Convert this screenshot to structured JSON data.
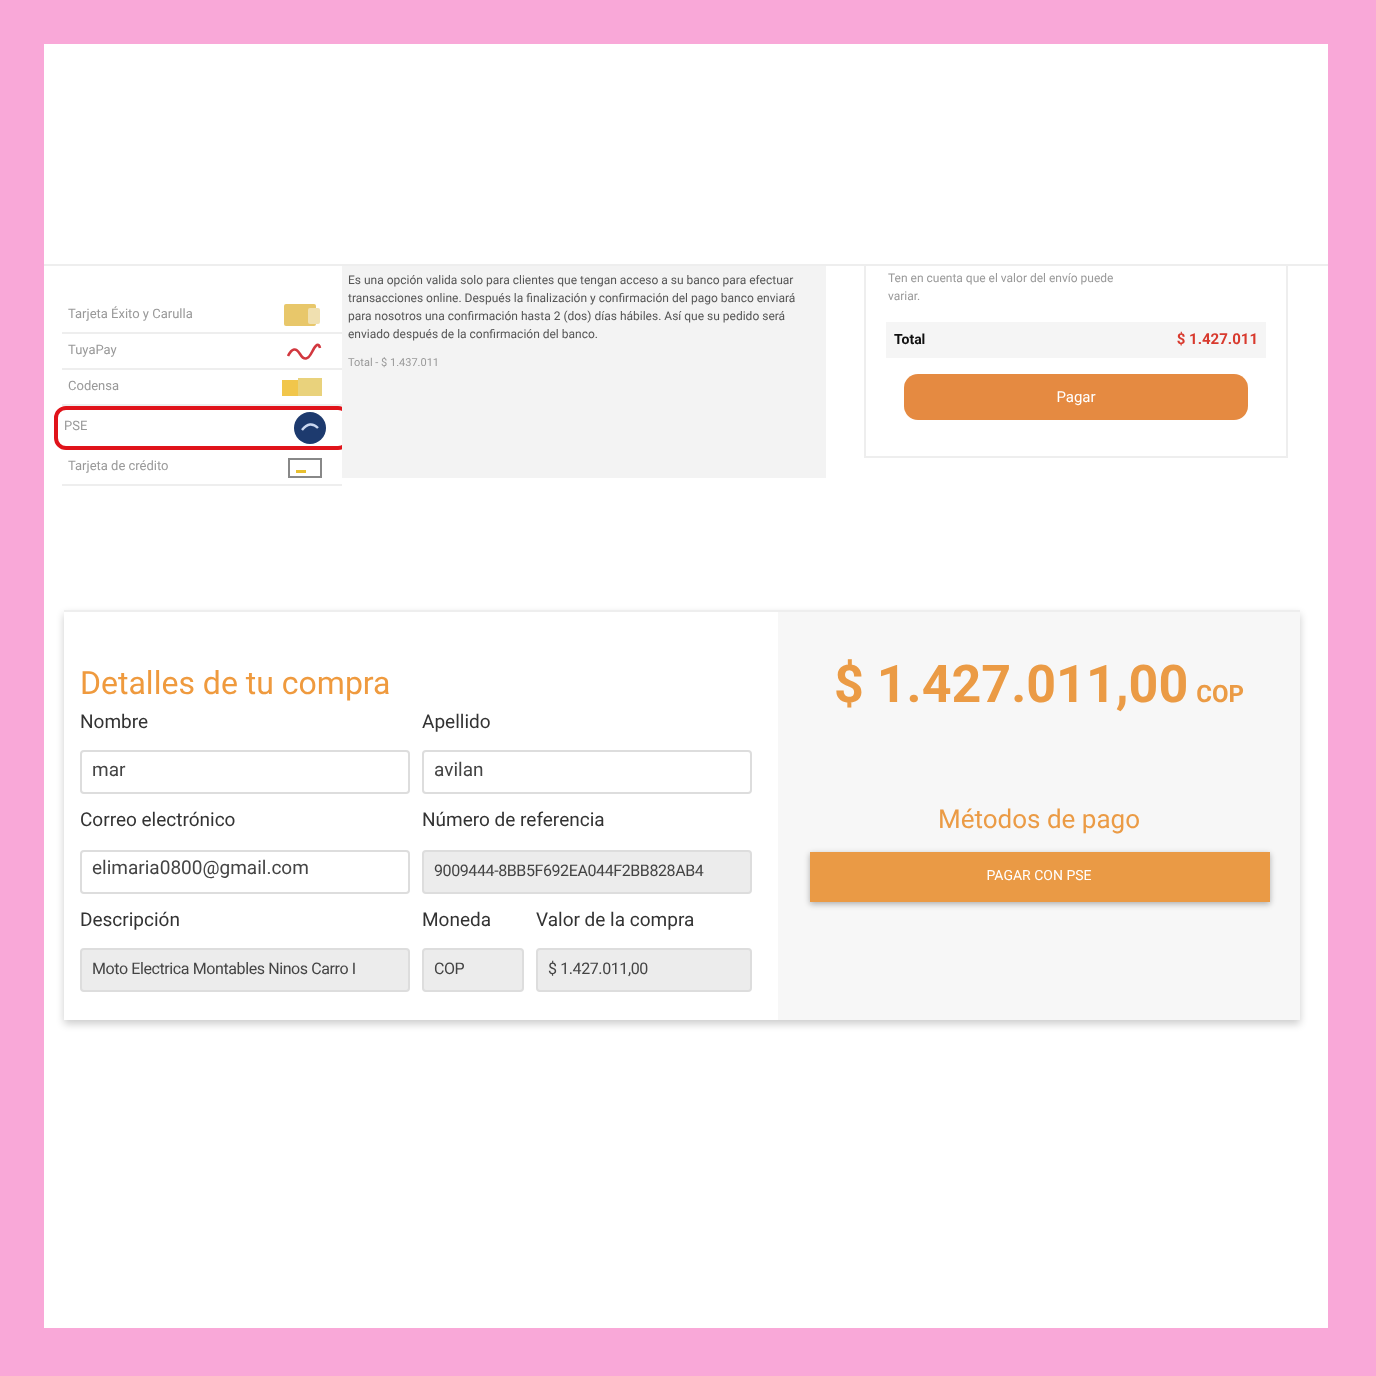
{
  "checkout": {
    "methods": [
      {
        "label": "Tarjeta Éxito y Carulla",
        "kind": "card-gold",
        "selected": false
      },
      {
        "label": "TuyaPay",
        "kind": "script-logo",
        "selected": false
      },
      {
        "label": "Codensa",
        "kind": "card-yellow",
        "selected": false
      },
      {
        "label": "PSE",
        "kind": "round-logo",
        "selected": true
      },
      {
        "label": "Tarjeta de crédito",
        "kind": "card-outline",
        "selected": false
      }
    ],
    "description": "Es una opción valida solo para clientes que tengan acceso a su banco para efectuar transacciones online. Después la finalización y confirmación del pago banco enviará para nosotros una confirmación hasta 2 (dos) días hábiles. Así que su pedido será enviado después de la confirmación del banco.",
    "total_line": "Total - $ 1.437.011",
    "note": "Ten en cuenta que el valor del envío puede variar.",
    "total_label": "Total",
    "total_value": "$ 1.427.011",
    "pay_button": "Pagar"
  },
  "payment": {
    "title": "Detalles de tu compra",
    "fields": [
      {
        "label": "Nombre",
        "value": "mar",
        "disabled": false
      },
      {
        "label": "Apellido",
        "value": "avilan",
        "disabled": false
      },
      {
        "label": "Correo electrónico",
        "value": "elimaria0800@gmail.com",
        "disabled": false
      },
      {
        "label": "Número de referencia",
        "value": "9009444-8BB5F692EA044F2BB828AB4",
        "disabled": true
      },
      {
        "label": "Descripción",
        "value": "Moto Electrica Montables Ninos Carro I",
        "disabled": true
      },
      {
        "label": "Moneda",
        "value": "COP",
        "disabled": true
      },
      {
        "label": "Valor de la compra",
        "value": "$ 1.427.011,00",
        "disabled": true
      }
    ],
    "amount": "$ 1.427.011,00",
    "currency": "COP",
    "methods_title": "Métodos de pago",
    "pse_button": "PAGAR CON PSE"
  }
}
